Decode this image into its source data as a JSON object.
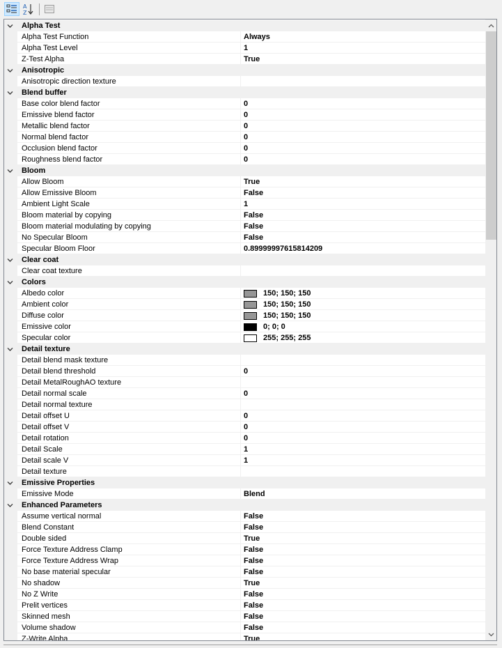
{
  "categories": [
    {
      "name": "Alpha Test",
      "properties": [
        {
          "name": "Alpha Test Function",
          "value": "Always"
        },
        {
          "name": "Alpha Test Level",
          "value": "1"
        },
        {
          "name": "Z-Test Alpha",
          "value": "True"
        }
      ]
    },
    {
      "name": "Anisotropic",
      "properties": [
        {
          "name": "Anisotropic direction texture",
          "value": ""
        }
      ]
    },
    {
      "name": "Blend buffer",
      "properties": [
        {
          "name": "Base color blend factor",
          "value": "0"
        },
        {
          "name": "Emissive blend factor",
          "value": "0"
        },
        {
          "name": "Metallic blend factor",
          "value": "0"
        },
        {
          "name": "Normal blend factor",
          "value": "0"
        },
        {
          "name": "Occlusion blend factor",
          "value": "0"
        },
        {
          "name": "Roughness blend factor",
          "value": "0"
        }
      ]
    },
    {
      "name": "Bloom",
      "properties": [
        {
          "name": "Allow Bloom",
          "value": "True"
        },
        {
          "name": "Allow Emissive Bloom",
          "value": "False"
        },
        {
          "name": "Ambient Light Scale",
          "value": "1"
        },
        {
          "name": "Bloom material by copying",
          "value": "False"
        },
        {
          "name": "Bloom material modulating by copying",
          "value": "False"
        },
        {
          "name": "No Specular Bloom",
          "value": "False"
        },
        {
          "name": "Specular Bloom Floor",
          "value": "0.89999997615814209"
        }
      ]
    },
    {
      "name": "Clear coat",
      "properties": [
        {
          "name": "Clear coat texture",
          "value": ""
        }
      ]
    },
    {
      "name": "Colors",
      "properties": [
        {
          "name": "Albedo color",
          "value": "150; 150; 150",
          "swatch": "#969696"
        },
        {
          "name": "Ambient color",
          "value": "150; 150; 150",
          "swatch": "#969696"
        },
        {
          "name": "Diffuse color",
          "value": "150; 150; 150",
          "swatch": "#969696"
        },
        {
          "name": "Emissive color",
          "value": "0; 0; 0",
          "swatch": "#000000"
        },
        {
          "name": "Specular color",
          "value": "255; 255; 255",
          "swatch": "#ffffff"
        }
      ]
    },
    {
      "name": "Detail texture",
      "properties": [
        {
          "name": "Detail blend mask texture",
          "value": ""
        },
        {
          "name": "Detail blend threshold",
          "value": "0"
        },
        {
          "name": "Detail MetalRoughAO texture",
          "value": ""
        },
        {
          "name": "Detail normal scale",
          "value": "0"
        },
        {
          "name": "Detail normal texture",
          "value": ""
        },
        {
          "name": "Detail offset U",
          "value": "0"
        },
        {
          "name": "Detail offset V",
          "value": "0"
        },
        {
          "name": "Detail rotation",
          "value": "0"
        },
        {
          "name": "Detail Scale",
          "value": "1"
        },
        {
          "name": "Detail scale V",
          "value": "1"
        },
        {
          "name": "Detail texture",
          "value": ""
        }
      ]
    },
    {
      "name": "Emissive Properties",
      "properties": [
        {
          "name": "Emissive Mode",
          "value": "Blend"
        }
      ]
    },
    {
      "name": "Enhanced Parameters",
      "properties": [
        {
          "name": "Assume vertical normal",
          "value": "False"
        },
        {
          "name": "Blend Constant",
          "value": "False"
        },
        {
          "name": "Double sided",
          "value": "True"
        },
        {
          "name": "Force Texture Address Clamp",
          "value": "False"
        },
        {
          "name": "Force Texture Address Wrap",
          "value": "False"
        },
        {
          "name": "No base material specular",
          "value": "False"
        },
        {
          "name": "No shadow",
          "value": "True"
        },
        {
          "name": "No Z Write",
          "value": "False"
        },
        {
          "name": "Prelit vertices",
          "value": "False"
        },
        {
          "name": "Skinned mesh",
          "value": "False"
        },
        {
          "name": "Volume shadow",
          "value": "False"
        },
        {
          "name": "Z-Write Alpha",
          "value": "True"
        }
      ]
    }
  ]
}
